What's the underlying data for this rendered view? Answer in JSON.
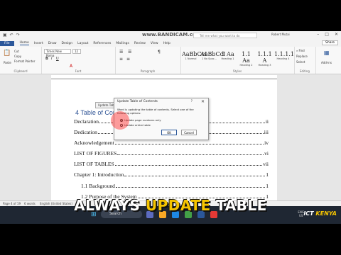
{
  "titlebar": {
    "recording_text": "www.BANDICAM.com",
    "search_placeholder": "Tell me what you want to do",
    "user": "Robert Mutai"
  },
  "tabs": [
    "File",
    "Home",
    "Insert",
    "Draw",
    "Design",
    "Layout",
    "References",
    "Mailings",
    "Review",
    "View",
    "Help"
  ],
  "share_label": "Share",
  "ribbon": {
    "paste": "Paste",
    "cut": "Cut",
    "copy": "Copy",
    "format_painter": "Format Painter",
    "clipboard": "Clipboard",
    "font_name": "Times New Roma",
    "font_size": "12",
    "font": "Font",
    "paragraph": "Paragraph",
    "styles": "Styles",
    "find": "Find",
    "replace": "Replace",
    "select": "Select",
    "editing": "Editing",
    "addins": "Add-ins",
    "style_items": [
      {
        "sample": "AaBbCcI",
        "name": "1 Normal"
      },
      {
        "sample": "AaBbCcI",
        "name": "1 No Spac..."
      },
      {
        "sample": "1 Aa",
        "name": "Heading 1"
      },
      {
        "sample": "1.1 Aa",
        "name": "Heading 2"
      },
      {
        "sample": "1.1.1 A",
        "name": "Heading 3"
      },
      {
        "sample": "1.1.1.1",
        "name": "Heading 4"
      }
    ]
  },
  "document": {
    "toc_control": "Update Table...",
    "toc_heading": "4   Table of Contents",
    "entries": [
      {
        "text": "Declaration",
        "page": "ii"
      },
      {
        "text": "Dedication",
        "page": "iii"
      },
      {
        "text": "Acknowledgement",
        "page": "iv"
      },
      {
        "text": "LIST OF FIGURES",
        "page": "vi"
      },
      {
        "text": "LIST OF TABLES",
        "page": "vii"
      },
      {
        "text": "Chapter 1: Introduction",
        "page": "1"
      },
      {
        "text": "1.1 Background",
        "page": "1"
      },
      {
        "text": "1.2 Purpose of the System",
        "page": "1"
      }
    ]
  },
  "dialog": {
    "title": "Update Table of Contents",
    "help": "?",
    "message": "Word is updating the table of contents. Select one of the following options:",
    "option1": "Update page numbers only",
    "option2": "Update entire table",
    "ok": "OK",
    "cancel": "Cancel"
  },
  "status": {
    "page": "Page 4 of 19",
    "words": "6 words",
    "lang": "English (United States)"
  },
  "taskbar": {
    "search": "Search",
    "tray_lang": "ENG",
    "tray_region": "US"
  },
  "caption": {
    "part1": "ALWAYS ",
    "part2": "UPDATE",
    "part3": " TABLE"
  },
  "brand": {
    "ict": "ICT ",
    "kenya": "KENYA"
  },
  "colors": {
    "accent": "#2b579a",
    "caption_highlight": "#f5c400",
    "heading": "#2f5496"
  }
}
